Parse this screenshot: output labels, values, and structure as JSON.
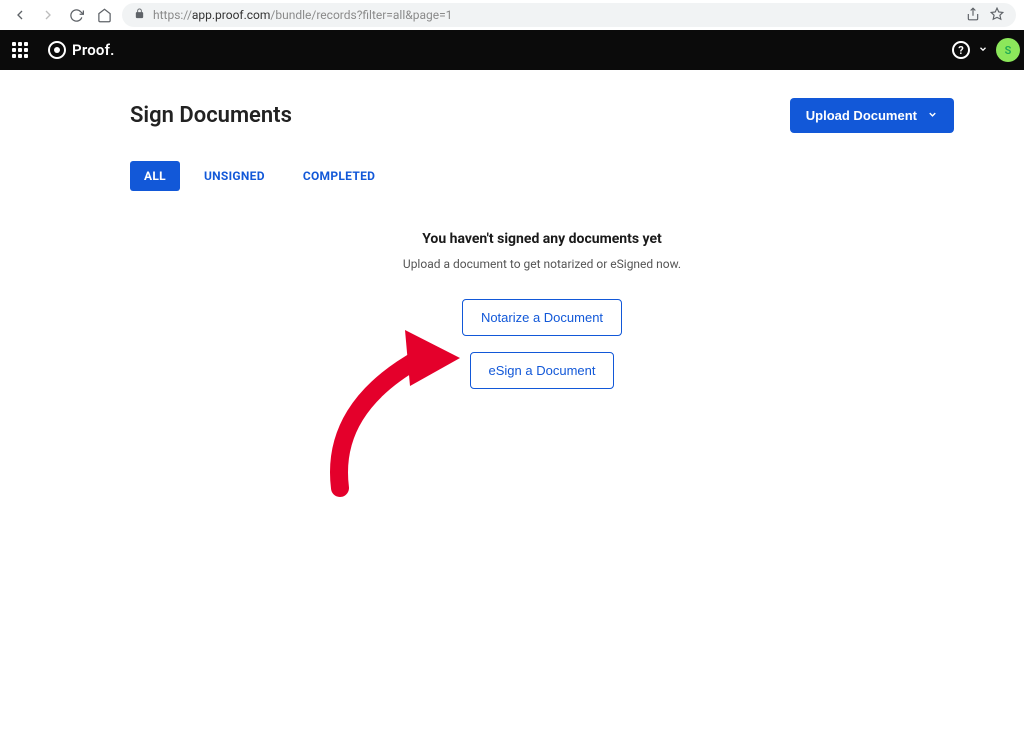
{
  "browser": {
    "url_host": "app.proof.com",
    "url_path": "/bundle/records?filter=all&page=1",
    "prefix": "https://"
  },
  "header": {
    "brand": "Proof.",
    "avatar_initial": "S"
  },
  "page": {
    "title": "Sign Documents",
    "upload_label": "Upload Document"
  },
  "tabs": [
    {
      "label": "ALL",
      "active": true
    },
    {
      "label": "UNSIGNED",
      "active": false
    },
    {
      "label": "COMPLETED",
      "active": false
    }
  ],
  "empty": {
    "title": "You haven't signed any documents yet",
    "subtitle": "Upload a document to get notarized or eSigned now.",
    "notarize_label": "Notarize a Document",
    "esign_label": "eSign a Document"
  }
}
